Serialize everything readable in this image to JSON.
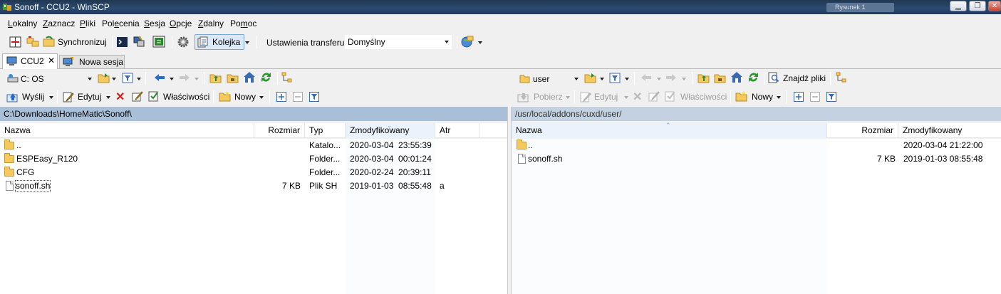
{
  "window": {
    "title": "Sonoff - CCU2 - WinSCP",
    "bg_task": "Rysunek 1"
  },
  "menu": [
    {
      "pre": "",
      "u": "L",
      "post": "okalny"
    },
    {
      "pre": "",
      "u": "Z",
      "post": "aznacz"
    },
    {
      "pre": "",
      "u": "P",
      "post": "liki"
    },
    {
      "pre": "Pol",
      "u": "e",
      "post": "cenia"
    },
    {
      "pre": "",
      "u": "S",
      "post": "esja"
    },
    {
      "pre": "",
      "u": "O",
      "post": "pcje"
    },
    {
      "pre": "",
      "u": "Z",
      "post": "dalny"
    },
    {
      "pre": "Po",
      "u": "m",
      "post": "oc"
    }
  ],
  "toolbar": {
    "synchronize_label": "Synchronizuj",
    "queue_label": "Kolejka",
    "transfer_settings_label": "Ustawienia transferu",
    "transfer_preset": "Domyślny"
  },
  "tabs": {
    "session": "CCU2",
    "close": "✕",
    "new_session": "Nowa sesja"
  },
  "left": {
    "drive": "C: OS",
    "send_label": "Wyślij",
    "edit_label": "Edytuj",
    "properties_label": "Właściwości",
    "new_label": "Nowy",
    "path": "C:\\Downloads\\HomeMatic\\Sonoff\\",
    "columns": {
      "name": "Nazwa",
      "size": "Rozmiar",
      "type": "Typ",
      "modified": "Zmodyfikowany",
      "attr": "Atr"
    },
    "rows": [
      {
        "name": "..",
        "size": "",
        "type": "Katalo...",
        "modified": "2020-03-04  23:55:39",
        "attr": "",
        "kind": "parent"
      },
      {
        "name": "ESPEasy_R120",
        "size": "",
        "type": "Folder...",
        "modified": "2020-03-04  00:01:24",
        "attr": "",
        "kind": "folder"
      },
      {
        "name": "CFG",
        "size": "",
        "type": "Folder...",
        "modified": "2020-02-24  20:39:11",
        "attr": "",
        "kind": "folder"
      },
      {
        "name": "sonoff.sh",
        "size": "7 KB",
        "type": "Plik SH",
        "modified": "2019-01-03  08:55:48",
        "attr": "a",
        "kind": "file"
      }
    ]
  },
  "right": {
    "directory": "user",
    "find_files_label": "Znajdź pliki",
    "download_label": "Pobierz",
    "edit_label": "Edytuj",
    "properties_label": "Właściwości",
    "new_label": "Nowy",
    "path": "/usr/local/addons/cuxd/user/",
    "columns": {
      "name": "Nazwa",
      "size": "Rozmiar",
      "modified": "Zmodyfikowany"
    },
    "rows": [
      {
        "name": "..",
        "size": "",
        "modified": "2020-03-04 21:22:00",
        "kind": "parent"
      },
      {
        "name": "sonoff.sh",
        "size": "7 KB",
        "modified": "2019-01-03 08:55:48",
        "kind": "file"
      }
    ]
  },
  "colors": {
    "path_active": "#a9bfd8",
    "path_inactive": "#c3d1e0",
    "header_sorted": "#eaf3fb",
    "accent": "#1e6ec8"
  }
}
